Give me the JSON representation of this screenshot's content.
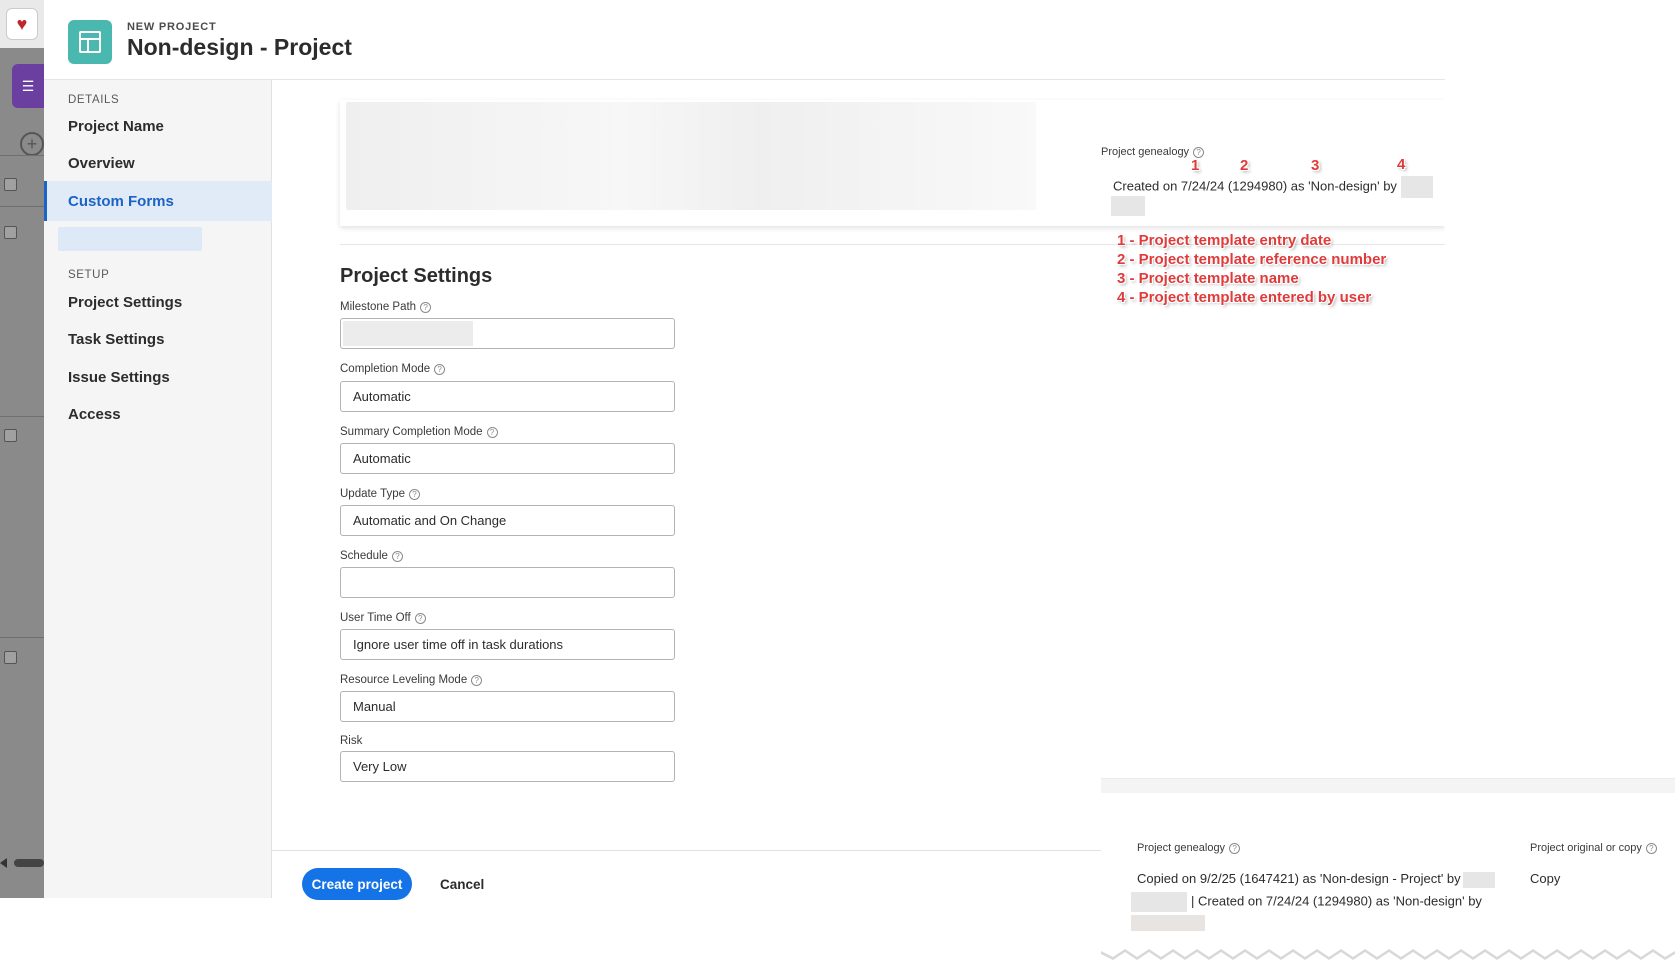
{
  "header": {
    "eyebrow": "NEW PROJECT",
    "title": "Non-design - Project",
    "icon": "project-template-icon"
  },
  "nav": {
    "details_label": "DETAILS",
    "details_items": [
      {
        "label": "Project Name"
      },
      {
        "label": "Overview"
      },
      {
        "label": "Custom Forms",
        "active": true
      }
    ],
    "setup_label": "SETUP",
    "setup_items": [
      {
        "label": "Project Settings"
      },
      {
        "label": "Task Settings"
      },
      {
        "label": "Issue Settings"
      },
      {
        "label": "Access"
      }
    ]
  },
  "settings": {
    "title": "Project Settings",
    "fields": [
      {
        "label": "Milestone Path",
        "value": ""
      },
      {
        "label": "Completion Mode",
        "value": "Automatic"
      },
      {
        "label": "Summary Completion Mode",
        "value": "Automatic"
      },
      {
        "label": "Update Type",
        "value": "Automatic and On Change"
      },
      {
        "label": "Schedule",
        "value": ""
      },
      {
        "label": "User Time Off",
        "value": "Ignore user time off in task durations"
      },
      {
        "label": "Resource Leveling Mode",
        "value": "Manual"
      },
      {
        "label": "Risk",
        "value": "Very Low"
      }
    ]
  },
  "footer": {
    "create_label": "Create project",
    "cancel_label": "Cancel"
  },
  "genealogy_top": {
    "label": "Project genealogy",
    "text": "Created on 7/24/24 (1294980) as 'Non-design' by",
    "markers": [
      "1",
      "2",
      "3",
      "4"
    ],
    "legend": [
      "1 - Project template entry date",
      "2 - Project template reference number",
      "3 - Project template name",
      "4 - Project template entered by user"
    ],
    "annotation_color": "#e03b3b"
  },
  "genealogy_bottom": {
    "label": "Project genealogy",
    "line1": "Copied on 9/2/25 (1647421) as 'Non-design - Project' by",
    "line2": "| Created on 7/24/24 (1294980) as 'Non-design' by",
    "original_label": "Project original or copy",
    "original_value": "Copy"
  },
  "colors": {
    "accent": "#1473e6",
    "active_nav": "#1b63c4",
    "project_icon": "#4bb8b0"
  }
}
